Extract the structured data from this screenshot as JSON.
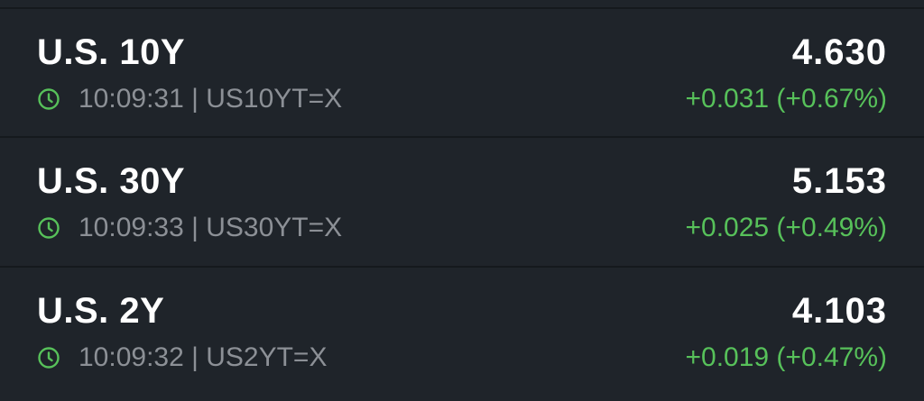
{
  "colors": {
    "background": "#1f242a",
    "divider": "#15191d",
    "primary_text": "#ffffff",
    "secondary_text": "#8c9096",
    "positive": "#57c15a"
  },
  "quotes": [
    {
      "name": "U.S. 10Y",
      "price": "4.630",
      "time": "10:09:31",
      "symbol": "US10YT=X",
      "meta": "10:09:31 | US10YT=X",
      "change": "+0.031 (+0.67%)",
      "icon": "clock-icon"
    },
    {
      "name": "U.S. 30Y",
      "price": "5.153",
      "time": "10:09:33",
      "symbol": "US30YT=X",
      "meta": "10:09:33 | US30YT=X",
      "change": "+0.025 (+0.49%)",
      "icon": "clock-icon"
    },
    {
      "name": "U.S. 2Y",
      "price": "4.103",
      "time": "10:09:32",
      "symbol": "US2YT=X",
      "meta": "10:09:32 | US2YT=X",
      "change": "+0.019 (+0.47%)",
      "icon": "clock-icon"
    }
  ]
}
